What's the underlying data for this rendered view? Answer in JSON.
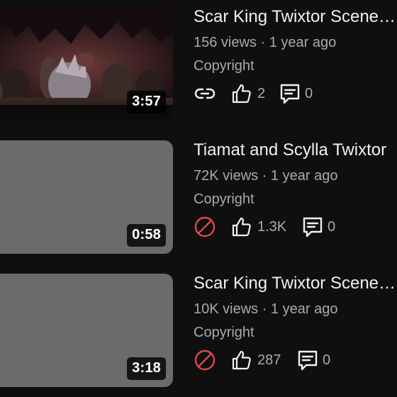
{
  "colors": {
    "background": "#0f0f0f",
    "title_text": "#f1f1f1",
    "secondary_text": "#aaaaaa",
    "blocked_icon": "#e5474b",
    "thumbnail_placeholder": "#6b6b6b"
  },
  "videos": [
    {
      "title": "Scar King Twixtor Scene…",
      "meta": "156 views · 1 year ago",
      "visibility": "Copyright",
      "duration": "3:57",
      "status_icon": "link-icon",
      "likes": "2",
      "comments": "0",
      "thumbnail": "image"
    },
    {
      "title": "Tiamat and Scylla Twixtor",
      "meta": "72K views · 1 year ago",
      "visibility": "Copyright",
      "duration": "0:58",
      "status_icon": "blocked-icon",
      "likes": "1.3K",
      "comments": "0",
      "thumbnail": "placeholder"
    },
    {
      "title": "Scar King Twixtor Scene…",
      "meta": "10K views · 1 year ago",
      "visibility": "Copyright",
      "duration": "3:18",
      "status_icon": "blocked-icon",
      "likes": "287",
      "comments": "0",
      "thumbnail": "placeholder"
    }
  ]
}
